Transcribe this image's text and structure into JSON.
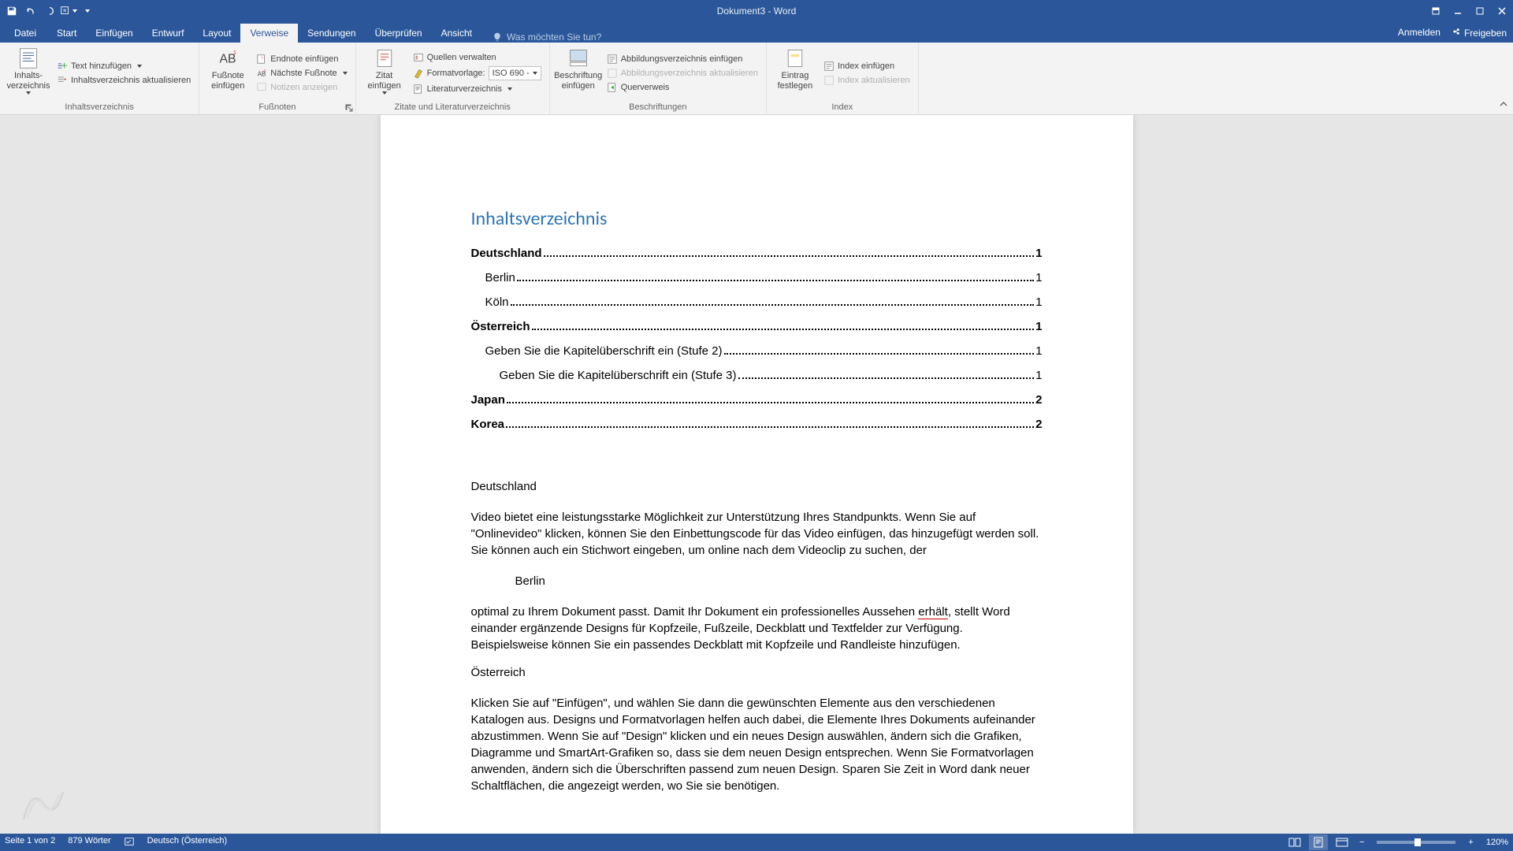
{
  "window": {
    "title": "Dokument3 - Word"
  },
  "qat": {
    "tooltips": [
      "Speichern",
      "Rückgängig",
      "Wiederholen",
      "Anpassen"
    ]
  },
  "tabs": {
    "file": "Datei",
    "items": [
      "Start",
      "Einfügen",
      "Entwurf",
      "Layout",
      "Verweise",
      "Sendungen",
      "Überprüfen",
      "Ansicht"
    ],
    "active_index": 4,
    "tellme_placeholder": "Was möchten Sie tun?",
    "signin": "Anmelden",
    "share": "Freigeben"
  },
  "ribbon": {
    "groups": {
      "toc": {
        "label": "Inhaltsverzeichnis",
        "big": "Inhalts-\nverzeichnis",
        "add_text": "Text hinzufügen",
        "update": "Inhaltsverzeichnis aktualisieren"
      },
      "footnotes": {
        "label": "Fußnoten",
        "big": "Fußnote\neinfügen",
        "insert_endnote": "Endnote einfügen",
        "next_footnote": "Nächste Fußnote",
        "show_notes": "Notizen anzeigen"
      },
      "citations": {
        "label": "Zitate und Literaturverzeichnis",
        "big": "Zitat\neinfügen",
        "manage_sources": "Quellen verwalten",
        "style_label": "Formatvorlage:",
        "style_value": "ISO 690 -",
        "bibliography": "Literaturverzeichnis"
      },
      "captions": {
        "label": "Beschriftungen",
        "big": "Beschriftung\neinfügen",
        "insert_tof": "Abbildungsverzeichnis einfügen",
        "update_tof": "Abbildungsverzeichnis aktualisieren",
        "crossref": "Querverweis"
      },
      "index": {
        "label": "Index",
        "big": "Eintrag\nfestlegen",
        "insert_index": "Index einfügen",
        "update_index": "Index aktualisieren"
      }
    }
  },
  "document": {
    "toc_title": "Inhaltsverzeichnis",
    "toc": [
      {
        "level": 1,
        "text": "Deutschland",
        "page": "1"
      },
      {
        "level": 2,
        "text": "Berlin",
        "page": "1"
      },
      {
        "level": 2,
        "text": "Köln",
        "page": "1"
      },
      {
        "level": 1,
        "text": "Österreich",
        "page": "1"
      },
      {
        "level": 2,
        "text": "Geben Sie die Kapitelüberschrift ein (Stufe 2)",
        "page": "1"
      },
      {
        "level": 3,
        "text": "Geben Sie die Kapitelüberschrift ein (Stufe 3)",
        "page": "1"
      },
      {
        "level": 1,
        "text": "Japan",
        "page": "2"
      },
      {
        "level": 1,
        "text": "Korea",
        "page": "2"
      }
    ],
    "h_deutschland": "Deutschland",
    "p1": "Video bietet eine leistungsstarke Möglichkeit zur Unterstützung Ihres Standpunkts. Wenn Sie auf \"Onlinevideo\" klicken, können Sie den Einbettungscode für das Video einfügen, das hinzugefügt werden soll. Sie können auch ein Stichwort eingeben, um online nach dem Videoclip zu suchen, der",
    "h_berlin": "Berlin",
    "p2_a": "optimal zu Ihrem Dokument passt. Damit Ihr Dokument ein professionelles Aussehen ",
    "p2_err": "erhält",
    "p2_b": ", stellt Word einander ergänzende Designs für Kopfzeile, Fußzeile, Deckblatt und Textfelder zur Verfügung. Beispielsweise können Sie ein passendes Deckblatt mit Kopfzeile und Randleiste hinzufügen.",
    "h_oesterreich": "Österreich",
    "p3": "Klicken Sie auf \"Einfügen\", und wählen Sie dann die gewünschten Elemente aus den verschiedenen Katalogen aus. Designs und Formatvorlagen helfen auch dabei, die Elemente Ihres Dokuments aufeinander abzustimmen. Wenn Sie auf \"Design\" klicken und ein neues Design auswählen, ändern sich die Grafiken, Diagramme und SmartArt-Grafiken so, dass sie dem neuen Design entsprechen. Wenn Sie Formatvorlagen anwenden, ändern sich die Überschriften passend zum neuen Design. Sparen Sie Zeit in Word dank neuer Schaltflächen, die angezeigt werden, wo Sie sie benötigen."
  },
  "statusbar": {
    "page": "Seite 1 von 2",
    "words": "879 Wörter",
    "language": "Deutsch (Österreich)",
    "zoom": "120%"
  }
}
